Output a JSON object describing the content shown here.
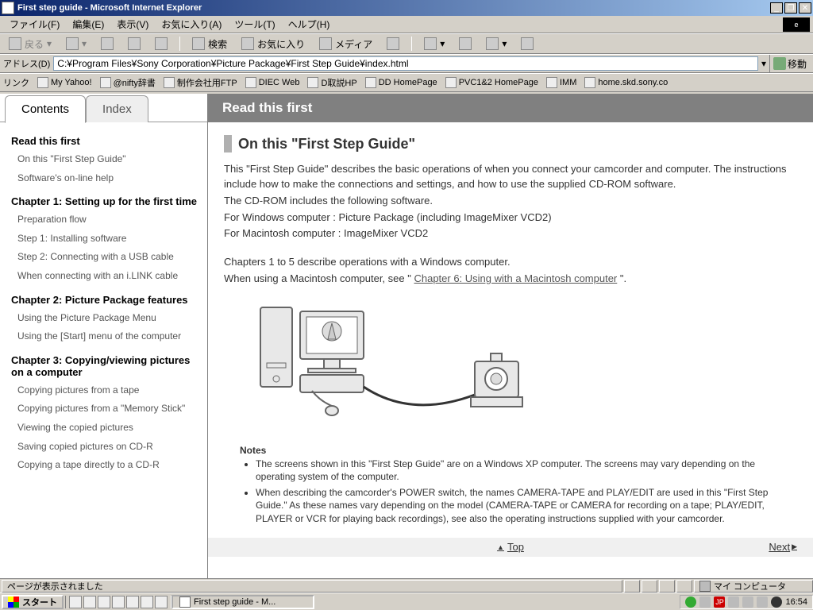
{
  "window": {
    "title": "First step guide - Microsoft Internet Explorer"
  },
  "menubar": {
    "file": "ファイル(F)",
    "edit": "編集(E)",
    "view": "表示(V)",
    "favorites": "お気に入り(A)",
    "tools": "ツール(T)",
    "help": "ヘルプ(H)"
  },
  "toolbar": {
    "back": "戻る",
    "search": "検索",
    "favorites": "お気に入り",
    "media": "メディア"
  },
  "address": {
    "label": "アドレス(D)",
    "value": "C:¥Program Files¥Sony Corporation¥Picture Package¥First Step Guide¥index.html",
    "go": "移動"
  },
  "linksbar": {
    "label": "リンク",
    "items": [
      "My Yahoo!",
      "@nifty辞書",
      "制作会社用FTP",
      "DIEC Web",
      "D取説HP",
      "DD HomePage",
      "PVC1&2 HomePage",
      "IMM",
      "home.skd.sony.co"
    ]
  },
  "tabs": {
    "contents": "Contents",
    "index": "Index"
  },
  "toc": {
    "s0": {
      "h": "Read this first",
      "i0": "On this \"First Step Guide\"",
      "i1": "Software's on-line help"
    },
    "s1": {
      "h": "Chapter 1: Setting up for the first time",
      "i0": "Preparation flow",
      "i1": "Step 1: Installing software",
      "i2": "Step 2: Connecting with a USB cable",
      "i3": "When connecting with an i.LINK cable"
    },
    "s2": {
      "h": "Chapter 2: Picture Package features",
      "i0": "Using the Picture Package Menu",
      "i1": "Using the [Start] menu of the computer"
    },
    "s3": {
      "h": "Chapter 3: Copying/viewing pictures on a computer",
      "i0": "Copying pictures from a tape",
      "i1": "Copying pictures from a \"Memory Stick\"",
      "i2": "Viewing the copied pictures",
      "i3": "Saving copied pictures on CD-R",
      "i4": "Copying a tape directly to a CD-R"
    }
  },
  "content": {
    "header": "Read this first",
    "title": "On this \"First Step Guide\"",
    "p1": "This \"First Step Guide\" describes the basic operations of when you connect your camcorder and computer. The instructions include how to make the connections and settings, and how to use the supplied CD-ROM software.",
    "p2": "The CD-ROM includes the following software.",
    "p3": "For Windows computer : Picture Package (including ImageMixer VCD2)",
    "p4": "For Macintosh computer : ImageMixer VCD2",
    "p5": "Chapters 1 to 5 describe operations with a Windows computer.",
    "p6a": "When using a Macintosh computer, see \" ",
    "p6link": "Chapter 6: Using with a Macintosh computer",
    "p6b": " \".",
    "notes_h": "Notes",
    "note1": "The screens shown in this \"First Step Guide\" are on a Windows XP computer. The screens may vary depending on the operating system of the computer.",
    "note2": "When describing the camcorder's POWER switch, the names CAMERA-TAPE and PLAY/EDIT are used in this \"First Step Guide.\" As these names vary depending on the model (CAMERA-TAPE or CAMERA for recording on a tape; PLAY/EDIT, PLAYER or VCR for playing back recordings), see also the operating instructions supplied with your camcorder.",
    "top": "Top",
    "next": "Next"
  },
  "status": {
    "done": "ページが表示されました",
    "mycomputer": "マイ コンピュータ"
  },
  "taskbar": {
    "start": "スタート",
    "task": "First step guide - M...",
    "ime": "JP",
    "clock": "16:54"
  }
}
